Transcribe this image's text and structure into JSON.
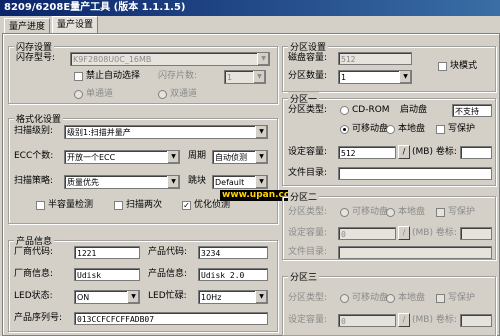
{
  "window": {
    "title": "8209/6208E量产工具 (版本 1.1.1.5)"
  },
  "tabs": [
    "量产进度",
    "量产设置"
  ],
  "flash": {
    "group_title": "闪存设置",
    "type_label": "闪存型号:",
    "type_value": "K9F2808U0C_16MB",
    "disable_autoselect": "禁止自动选择",
    "chip_count_label": "闪存片数:",
    "chip_count_value": "1",
    "single_channel": "单通道",
    "dual_channel": "双通道"
  },
  "format": {
    "group_title": "格式化设置",
    "scan_level_label": "扫描级别:",
    "scan_level_value": "级别1:扫描并量产",
    "ecc_label": "ECC个数:",
    "ecc_value": "开放一个ECC",
    "cycle_label": "周期",
    "cycle_value": "自动侦测",
    "strategy_label": "扫描策略:",
    "strategy_value": "质量优先",
    "skip_label": "跳块",
    "skip_value": "Default",
    "half_capacity": "半容量检测",
    "scan_twice": "扫描两次",
    "optimize_detect": "优化侦测"
  },
  "product": {
    "group_title": "产品信息",
    "vendor_code_label": "厂商代码:",
    "vendor_code_value": "1221",
    "product_code_label": "产品代码:",
    "product_code_value": "3234",
    "vendor_info_label": "厂商信息:",
    "vendor_info_value": "Udisk",
    "product_info_label": "产品信息:",
    "product_info_value": "Udisk 2.0",
    "led_state_label": "LED状态:",
    "led_state_value": "ON",
    "led_freq_label": "LED忙碌:",
    "led_freq_value": "10Hz",
    "serial_label": "产品序列号:",
    "serial_value": "013CCFCFCFFADB07"
  },
  "partition": {
    "group_title": "分区设置",
    "disk_capacity_label": "磁盘容量:",
    "disk_capacity_value": "512",
    "count_label": "分区数量:",
    "count_value": "1",
    "block_mode": "块模式"
  },
  "part1": {
    "title": "分区一",
    "type_label": "分区类型:",
    "cdrom": "CD-ROM",
    "boot_label": "启动盘",
    "boot_value": "不支持",
    "removable": "可移动盘",
    "local": "本地盘",
    "write_protect": "写保护",
    "capacity_label": "设定容量:",
    "capacity_value": "512",
    "slash": "/",
    "unit": "(MB) 卷标:",
    "filelist_label": "文件目录:"
  },
  "part2": {
    "title": "分区二",
    "type_label": "分区类型:",
    "removable": "可移动盘",
    "local": "本地盘",
    "write_protect": "写保护",
    "capacity_label": "设定容量:",
    "capacity_value": "0",
    "slash": "/",
    "unit": "(MB) 卷标:",
    "filelist_label": "文件目录:"
  },
  "part3": {
    "title": "分区三",
    "type_label": "分区类型:",
    "removable": "可移动盘",
    "local": "本地盘",
    "write_protect": "写保护",
    "capacity_label": "设定容量:",
    "capacity_value": "0",
    "slash": "/",
    "unit": "(MB) 卷标:"
  },
  "watermark": "www.upan.cc",
  "check_mark": "✓",
  "arrow_glyph": "▼"
}
